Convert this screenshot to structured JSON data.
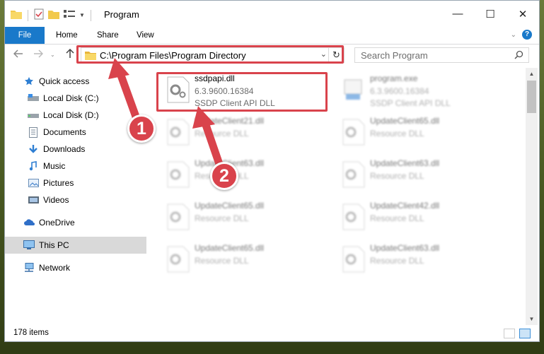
{
  "window": {
    "title": "Program",
    "controls": {
      "minimize": "—",
      "maximize": "☐",
      "close": "✕"
    }
  },
  "ribbon": {
    "tabs": [
      "File",
      "Home",
      "Share",
      "View"
    ]
  },
  "navigation": {
    "address": "C:\\Program Files\\Program Directory",
    "search_placeholder": "Search Program"
  },
  "sidebar": {
    "items": [
      {
        "label": "Quick access",
        "icon": "star-icon"
      },
      {
        "label": "Local Disk (C:)",
        "icon": "drive-icon"
      },
      {
        "label": "Local Disk (D:)",
        "icon": "drive-icon"
      },
      {
        "label": "Documents",
        "icon": "documents-icon"
      },
      {
        "label": "Downloads",
        "icon": "download-icon"
      },
      {
        "label": "Music",
        "icon": "music-icon"
      },
      {
        "label": "Pictures",
        "icon": "pictures-icon"
      },
      {
        "label": "Videos",
        "icon": "videos-icon"
      },
      {
        "label": "OneDrive",
        "icon": "cloud-icon"
      },
      {
        "label": "This PC",
        "icon": "computer-icon"
      },
      {
        "label": "Network",
        "icon": "network-icon"
      }
    ]
  },
  "files": [
    {
      "name": "ssdpapi.dll",
      "version": "6.3.9600.16384",
      "description": "SSDP Client API DLL",
      "icon": "dll-gear-icon"
    },
    {
      "name": "program.exe",
      "version": "6.3.9600.16384",
      "description": "SSDP Client API DLL",
      "icon": "exe-icon"
    },
    {
      "name": "UpdateClient21.dll",
      "description": "Resource DLL",
      "icon": "dll-gear-icon"
    },
    {
      "name": "UpdateClient65.dll",
      "description": "Resource DLL",
      "icon": "dll-gear-icon"
    },
    {
      "name": "UpdateClient63.dll",
      "description": "Resource DLL",
      "icon": "dll-gear-icon"
    },
    {
      "name": "UpdateClient63.dll",
      "description": "Resource DLL",
      "icon": "dll-gear-icon"
    },
    {
      "name": "UpdateClient65.dll",
      "description": "Resource DLL",
      "icon": "dll-gear-icon"
    },
    {
      "name": "UpdateClient42.dll",
      "description": "Resource DLL",
      "icon": "dll-gear-icon"
    },
    {
      "name": "UpdateClient65.dll",
      "description": "Resource DLL",
      "icon": "dll-gear-icon"
    },
    {
      "name": "UpdateClient63.dll",
      "description": "Resource DLL",
      "icon": "dll-gear-icon"
    }
  ],
  "status": {
    "items_count": "178 items"
  },
  "annotations": {
    "step1": "1",
    "step2": "2",
    "highlight_color": "#d9434c"
  },
  "colors": {
    "accent": "#1979ca",
    "selected_bg": "#d9d9d9"
  }
}
